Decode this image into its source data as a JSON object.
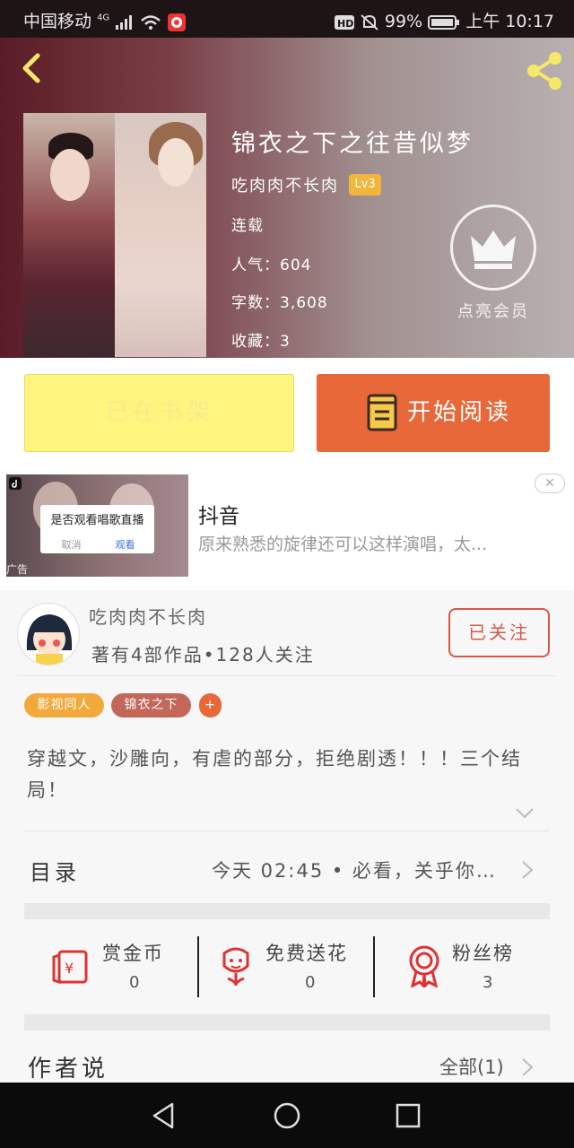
{
  "status_bar": {
    "carrier": "中国移动",
    "network": "4G",
    "battery": "99%",
    "time": "上午 10:17"
  },
  "book": {
    "title": "锦衣之下之往昔似梦",
    "author": "吃肉肉不长肉",
    "level": "Lv3",
    "status": "连载",
    "popularity": "人气：604",
    "word_count": "字数：3,608",
    "favorites": "收藏：3",
    "vip_label": "点亮会员"
  },
  "actions": {
    "shelf_label": "已在书架",
    "read_label": "开始阅读"
  },
  "ad": {
    "popup_question": "是否观看唱歌直播",
    "popup_cancel": "取消",
    "popup_watch": "观看",
    "tag": "广告",
    "title": "抖音",
    "description": "原来熟悉的旋律还可以这样演唱，太..."
  },
  "author_card": {
    "name": "吃肉肉不长肉",
    "info": "著有4部作品•128人关注",
    "follow_label": "已关注"
  },
  "tags": [
    {
      "label": "影视同人",
      "color": "#f2a93b"
    },
    {
      "label": "锦衣之下",
      "color": "#c2675a"
    },
    {
      "label": "+",
      "color": "#e8683a"
    }
  ],
  "description": "穿越文，沙雕向，有虐的部分，拒绝剧透！！！三个结局！",
  "toc": {
    "label": "目录",
    "latest": "今天  02:45 • 必看，关乎你…"
  },
  "stats": [
    {
      "label": "赏金币",
      "value": "0",
      "icon": "coin-envelope-icon"
    },
    {
      "label": "免费送花",
      "value": "0",
      "icon": "flower-icon"
    },
    {
      "label": "粉丝榜",
      "value": "3",
      "icon": "medal-icon"
    }
  ],
  "author_says": {
    "label": "作者说",
    "all": "全部(1)"
  },
  "colors": {
    "accent": "#e8683a",
    "shelf_button": "#fff47e",
    "level_badge": "#f2b63a",
    "follow_border": "#d9584a"
  }
}
